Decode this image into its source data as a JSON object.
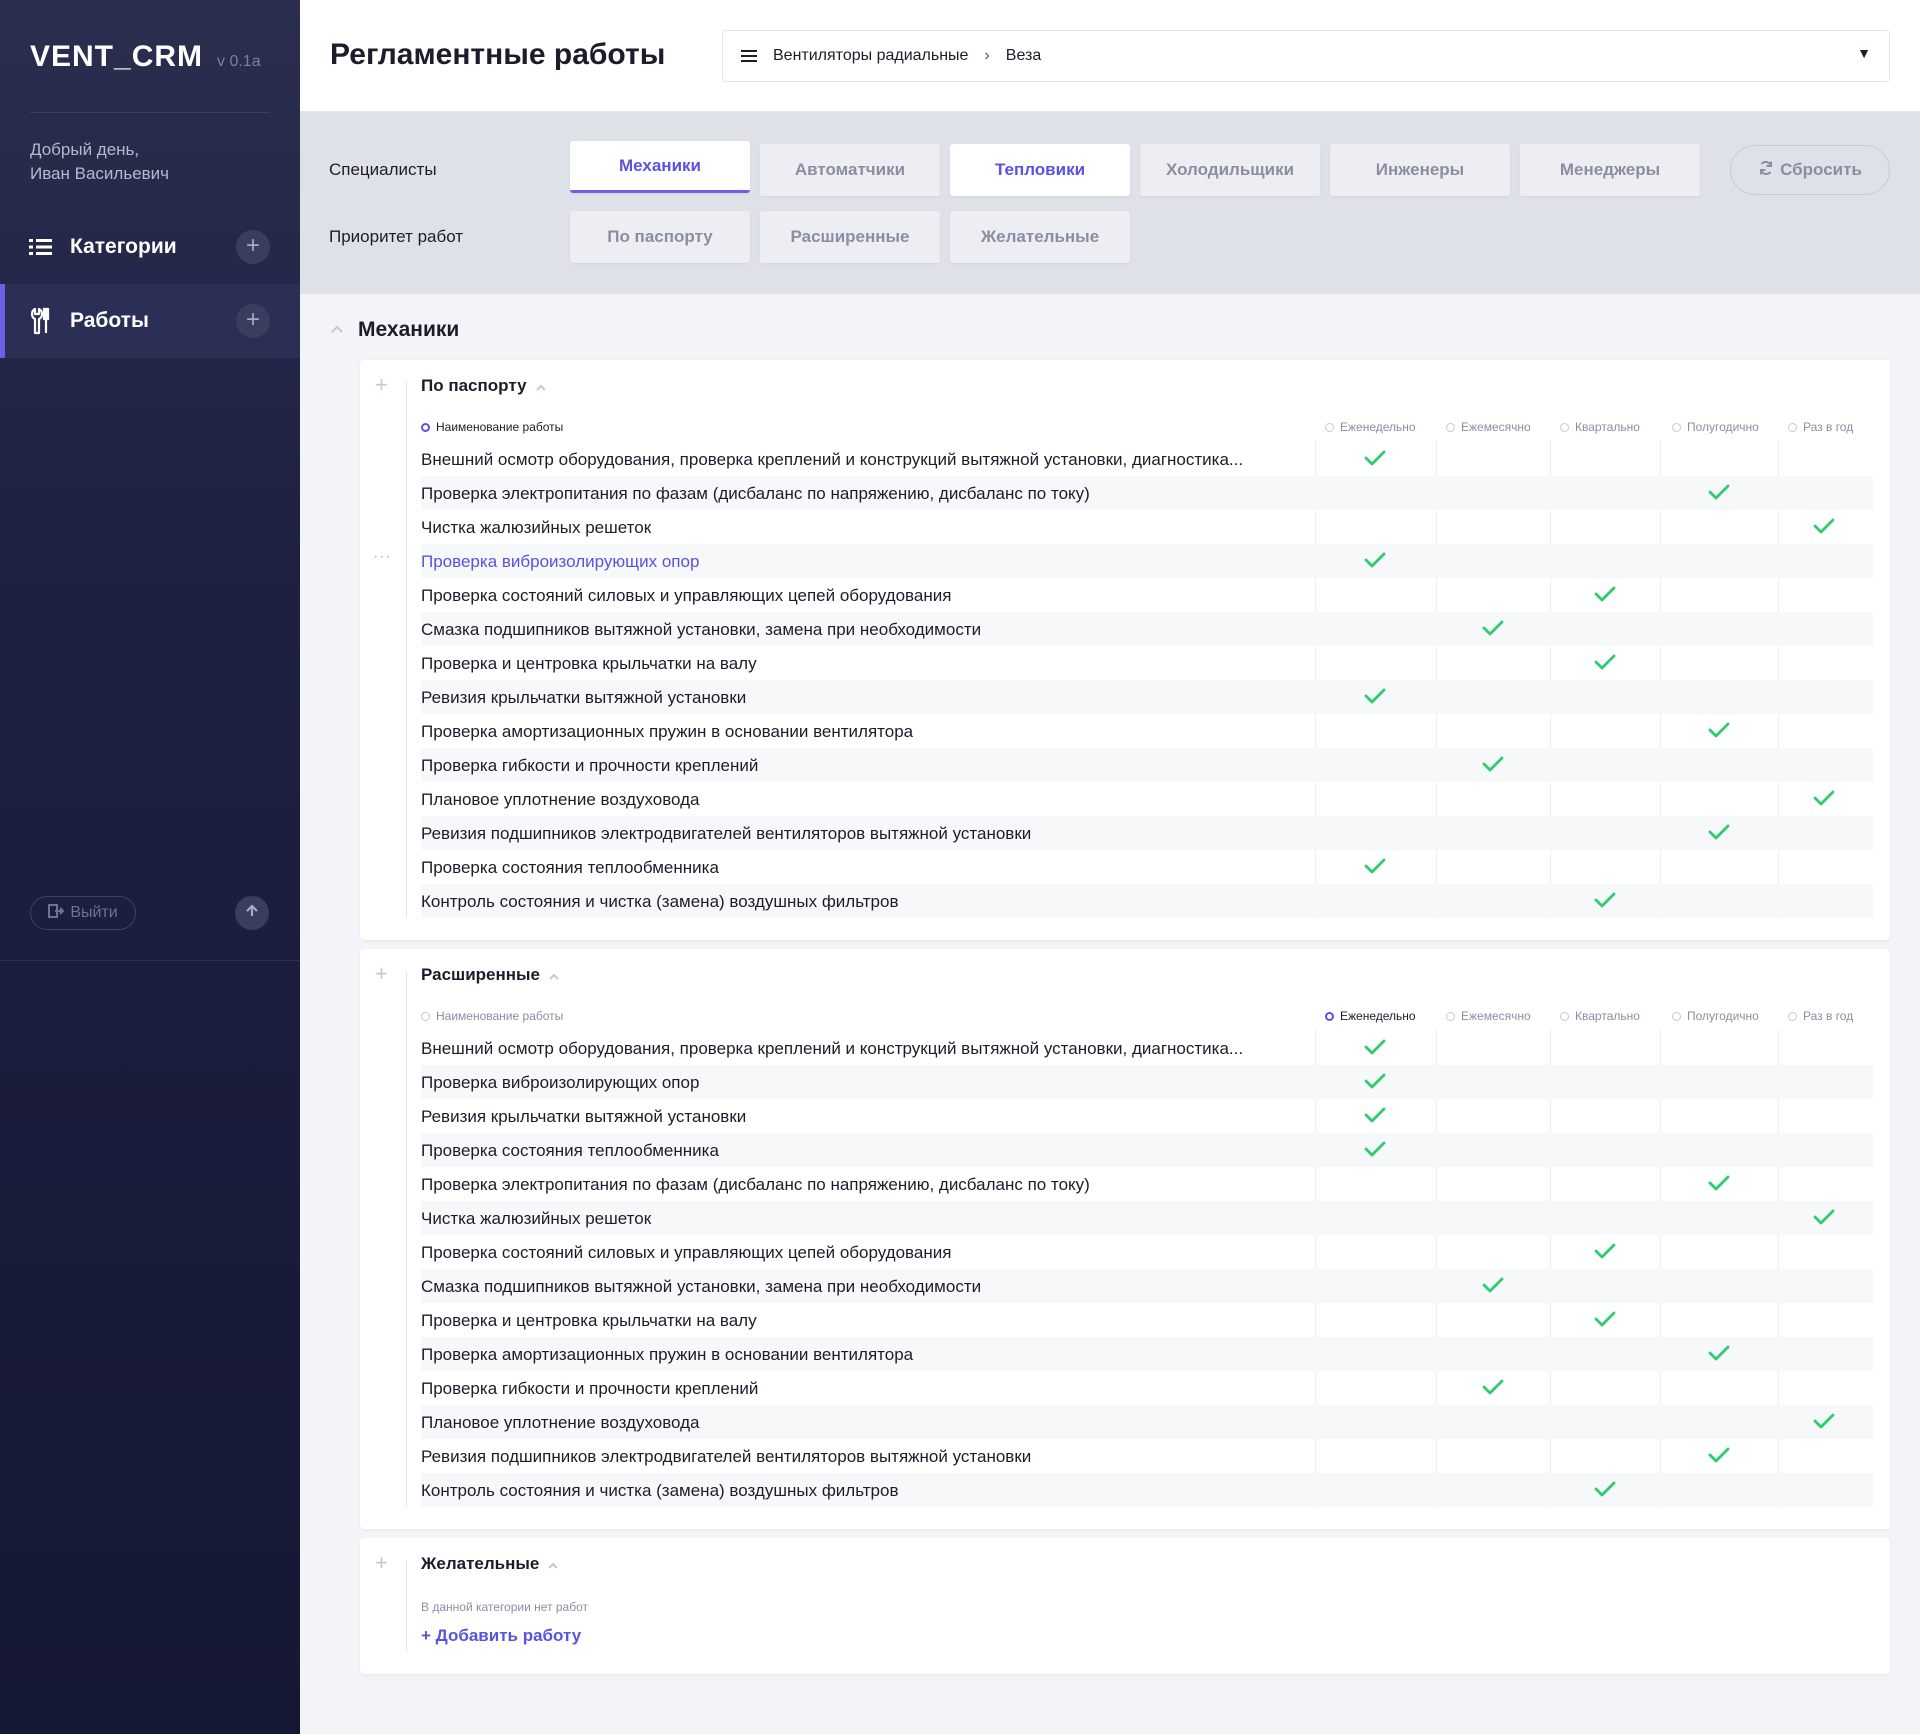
{
  "app": {
    "name": "VENT_CRM",
    "version": "v 0.1a"
  },
  "sidebar": {
    "greeting_line1": "Добрый день,",
    "greeting_line2": "Иван Васильевич",
    "nav": [
      {
        "label": "Категории",
        "icon": "list-icon",
        "active": false
      },
      {
        "label": "Работы",
        "icon": "wrench-icon",
        "active": true
      }
    ],
    "logout_label": "Выйти"
  },
  "header": {
    "title": "Регламентные работы",
    "breadcrumb": [
      "Вентиляторы радиальные",
      "Веза"
    ]
  },
  "filters": {
    "specialists_label": "Специалисты",
    "specialists": [
      {
        "label": "Механики",
        "state": "active"
      },
      {
        "label": "Автоматчики",
        "state": "off"
      },
      {
        "label": "Тепловики",
        "state": "selected"
      },
      {
        "label": "Холодильщики",
        "state": "off"
      },
      {
        "label": "Инженеры",
        "state": "off"
      },
      {
        "label": "Менеджеры",
        "state": "off"
      }
    ],
    "priority_label": "Приоритет работ",
    "priorities": [
      "По паспорту",
      "Расширенные",
      "Желательные"
    ],
    "reset_label": "Сбросить"
  },
  "group": {
    "title": "Механики"
  },
  "columns": {
    "name": "Наименование работы",
    "periods": [
      "Еженедельно",
      "Ежемесячно",
      "Квартально",
      "Полугодично",
      "Раз в год"
    ]
  },
  "sections": [
    {
      "title": "По паспорту",
      "sort": "name",
      "rows": [
        {
          "name": "Внешний осмотр оборудования, проверка креплений и конструкций вытяжной установки, диагностика...",
          "period": 0
        },
        {
          "name": "Проверка электропитания по фазам (дисбаланс по напряжению, дисбаланс по току)",
          "period": 3
        },
        {
          "name": "Чистка жалюзийных решеток",
          "period": 4
        },
        {
          "name": "Проверка виброизолирующих опор",
          "period": 0,
          "highlight": true
        },
        {
          "name": "Проверка состояний силовых и управляющих цепей оборудования",
          "period": 2
        },
        {
          "name": "Смазка подшипников вытяжной установки, замена при необходимости",
          "period": 1
        },
        {
          "name": "Проверка и центровка крыльчатки на валу",
          "period": 2
        },
        {
          "name": "Ревизия крыльчатки вытяжной установки",
          "period": 0
        },
        {
          "name": "Проверка амортизационных пружин в основании вентилятора",
          "period": 3
        },
        {
          "name": "Проверка гибкости и прочности креплений",
          "period": 1
        },
        {
          "name": "Плановое уплотнение воздуховода",
          "period": 4
        },
        {
          "name": "Ревизия подшипников электродвигателей вентиляторов вытяжной установки",
          "period": 3
        },
        {
          "name": "Проверка состояния теплообменника",
          "period": 0
        },
        {
          "name": "Контроль состояния и чистка (замена) воздушных фильтров",
          "period": 2
        }
      ]
    },
    {
      "title": "Расширенные",
      "sort": "period0",
      "rows": [
        {
          "name": "Внешний осмотр оборудования, проверка креплений и конструкций вытяжной установки, диагностика...",
          "period": 0
        },
        {
          "name": "Проверка виброизолирующих опор",
          "period": 0
        },
        {
          "name": "Ревизия крыльчатки вытяжной установки",
          "period": 0
        },
        {
          "name": "Проверка состояния теплообменника",
          "period": 0
        },
        {
          "name": "Проверка электропитания по фазам (дисбаланс по напряжению, дисбаланс по току)",
          "period": 3
        },
        {
          "name": "Чистка жалюзийных решеток",
          "period": 4
        },
        {
          "name": "Проверка состояний силовых и управляющих цепей оборудования",
          "period": 2
        },
        {
          "name": "Смазка подшипников вытяжной установки, замена при необходимости",
          "period": 1
        },
        {
          "name": "Проверка и центровка крыльчатки на валу",
          "period": 2
        },
        {
          "name": "Проверка амортизационных пружин в основании вентилятора",
          "period": 3
        },
        {
          "name": "Проверка гибкости и прочности креплений",
          "period": 1
        },
        {
          "name": "Плановое уплотнение воздуховода",
          "period": 4
        },
        {
          "name": "Ревизия подшипников электродвигателей вентиляторов вытяжной установки",
          "period": 3
        },
        {
          "name": "Контроль состояния и чистка (замена) воздушных фильтров",
          "period": 2
        }
      ]
    },
    {
      "title": "Желательные",
      "empty_text": "В данной категории нет работ",
      "add_label": "+ Добавить работу",
      "rows": []
    }
  ],
  "colors": {
    "accent": "#5b52e0",
    "check": "#2ecc71",
    "sidebar": "#1d2040"
  }
}
